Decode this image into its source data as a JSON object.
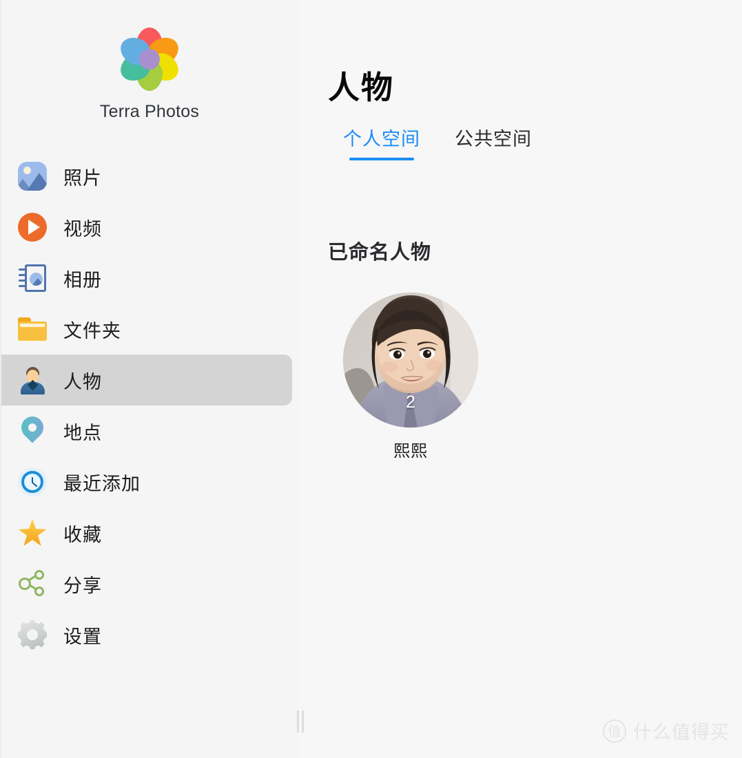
{
  "app": {
    "brand_name": "Terra Photos",
    "logo": {
      "name": "flower-logo",
      "petal_colors": [
        "#f8595c",
        "#f89a14",
        "#f0e000",
        "#a4cd42",
        "#46bd9c",
        "#63aee0"
      ],
      "center_color": "#a98fcd"
    }
  },
  "sidebar": {
    "items": [
      {
        "label": "照片",
        "icon": "photos-icon",
        "selected": false
      },
      {
        "label": "视频",
        "icon": "video-icon",
        "selected": false
      },
      {
        "label": "相册",
        "icon": "album-icon",
        "selected": false
      },
      {
        "label": "文件夹",
        "icon": "folder-icon",
        "selected": false
      },
      {
        "label": "人物",
        "icon": "person-icon",
        "selected": true
      },
      {
        "label": "地点",
        "icon": "location-pin-icon",
        "selected": false
      },
      {
        "label": "最近添加",
        "icon": "clock-icon",
        "selected": false
      },
      {
        "label": "收藏",
        "icon": "star-icon",
        "selected": false
      },
      {
        "label": "分享",
        "icon": "share-icon",
        "selected": false
      },
      {
        "label": "设置",
        "icon": "gear-icon",
        "selected": false
      }
    ],
    "selected_bg": "#d4d4d4"
  },
  "main": {
    "page_title": "人物",
    "tabs": [
      {
        "label": "个人空间",
        "active": true
      },
      {
        "label": "公共空间",
        "active": false
      }
    ],
    "accent_color": "#1a8cf5",
    "section_title": "已命名人物",
    "people": [
      {
        "name": "熙熙",
        "count": "2"
      }
    ]
  },
  "watermark": {
    "badge": "值",
    "text": "什么值得买"
  }
}
